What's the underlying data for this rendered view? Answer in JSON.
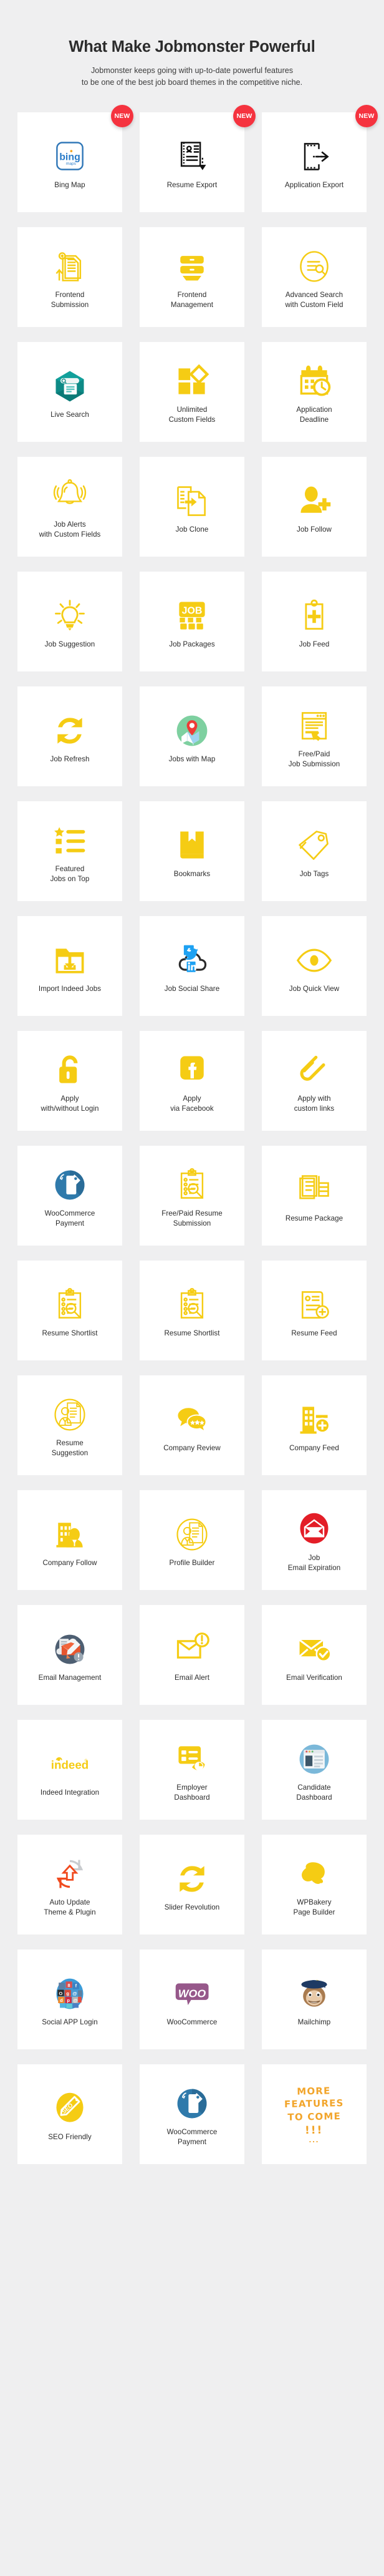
{
  "header": {
    "title": "What Make Jobmonster Powerful",
    "subtitle_line1": "Jobmonster keeps going with up-to-date powerful features",
    "subtitle_line2": "to be one of the best job board themes in the competitive niche."
  },
  "badge": {
    "new_label": "NEW"
  },
  "colors": {
    "background": "#efeff0",
    "card_background": "#ffffff",
    "accent_yellow": "#f5cc14",
    "badge_red": "#f5333f",
    "text": "#2b2b2b",
    "heading": "#2c2c2c",
    "orange_handwriting": "#f2a52b",
    "teal": "#0e8a86",
    "blue": "#3178b8",
    "facebook_blue": "#1da1f2",
    "woo_purple": "#96588a",
    "green": "#7ed0a0"
  },
  "features": [
    {
      "label": "Bing Map",
      "icon": "bing-map-icon",
      "badge": "NEW"
    },
    {
      "label": "Resume Export",
      "icon": "resume-export-icon",
      "badge": "NEW"
    },
    {
      "label": "Application Export",
      "icon": "application-export-icon",
      "badge": "NEW"
    },
    {
      "label": "Frontend\nSubmission",
      "icon": "frontend-submission-icon",
      "badge": ""
    },
    {
      "label": "Frontend\nManagement",
      "icon": "frontend-management-icon",
      "badge": ""
    },
    {
      "label": "Advanced Search\nwith Custom Field",
      "icon": "advanced-search-icon",
      "badge": ""
    },
    {
      "label": "Live Search",
      "icon": "live-search-icon",
      "badge": ""
    },
    {
      "label": "Unlimited\nCustom Fields",
      "icon": "unlimited-custom-fields-icon",
      "badge": ""
    },
    {
      "label": "Application\nDeadline",
      "icon": "application-deadline-icon",
      "badge": ""
    },
    {
      "label": "Job Alerts\nwith Custom Fields",
      "icon": "job-alerts-bell-icon",
      "badge": ""
    },
    {
      "label": "Job Clone",
      "icon": "job-clone-icon",
      "badge": ""
    },
    {
      "label": "Job Follow",
      "icon": "job-follow-user-plus-icon",
      "badge": ""
    },
    {
      "label": "Job Suggestion",
      "icon": "job-suggestion-lightbulb-icon",
      "badge": ""
    },
    {
      "label": "Job Packages",
      "icon": "job-packages-icon",
      "badge": ""
    },
    {
      "label": "Job Feed",
      "icon": "job-feed-icon",
      "badge": ""
    },
    {
      "label": "Job Refresh",
      "icon": "job-refresh-icon",
      "badge": ""
    },
    {
      "label": "Jobs with Map",
      "icon": "jobs-with-map-icon",
      "badge": ""
    },
    {
      "label": "Free/Paid\nJob Submission",
      "icon": "free-paid-job-submission-icon",
      "badge": ""
    },
    {
      "label": "Featured\nJobs on Top",
      "icon": "featured-jobs-list-icon",
      "badge": ""
    },
    {
      "label": "Bookmarks",
      "icon": "bookmarks-book-icon",
      "badge": ""
    },
    {
      "label": "Job Tags",
      "icon": "job-tags-icon",
      "badge": ""
    },
    {
      "label": "Import Indeed Jobs",
      "icon": "import-indeed-jobs-icon",
      "badge": ""
    },
    {
      "label": "Job Social Share",
      "icon": "job-social-share-icon",
      "badge": ""
    },
    {
      "label": "Job Quick View",
      "icon": "job-quick-view-eye-icon",
      "badge": ""
    },
    {
      "label": "Apply\nwith/without Login",
      "icon": "apply-lock-icon",
      "badge": ""
    },
    {
      "label": "Apply\nvia Facebook",
      "icon": "apply-facebook-icon",
      "badge": ""
    },
    {
      "label": "Apply with\ncustom links",
      "icon": "apply-custom-link-icon",
      "badge": ""
    },
    {
      "label": "WooCommerce\nPayment",
      "icon": "woocommerce-payment-icon",
      "badge": ""
    },
    {
      "label": "Free/Paid Resume\nSubmission",
      "icon": "free-paid-resume-icon",
      "badge": ""
    },
    {
      "label": "Resume Package",
      "icon": "resume-package-icon",
      "badge": ""
    },
    {
      "label": "Resume Shortlist",
      "icon": "resume-shortlist-icon",
      "badge": ""
    },
    {
      "label": "Resume Shortlist",
      "icon": "resume-shortlist-icon",
      "badge": ""
    },
    {
      "label": "Resume Feed",
      "icon": "resume-feed-icon",
      "badge": ""
    },
    {
      "label": "Resume\nSuggestion",
      "icon": "resume-suggestion-icon",
      "badge": ""
    },
    {
      "label": "Company Review",
      "icon": "company-review-icon",
      "badge": ""
    },
    {
      "label": "Company Feed",
      "icon": "company-feed-icon",
      "badge": ""
    },
    {
      "label": "Company Follow",
      "icon": "company-follow-icon",
      "badge": ""
    },
    {
      "label": "Profile Builder",
      "icon": "profile-builder-icon",
      "badge": ""
    },
    {
      "label": "Job\nEmail Expiration",
      "icon": "job-email-expiration-icon",
      "badge": ""
    },
    {
      "label": "Email Management",
      "icon": "email-management-icon",
      "badge": ""
    },
    {
      "label": "Email Alert",
      "icon": "email-alert-icon",
      "badge": ""
    },
    {
      "label": "Email Verification",
      "icon": "email-verification-icon",
      "badge": ""
    },
    {
      "label": "Indeed Integration",
      "icon": "indeed-logo-icon",
      "badge": ""
    },
    {
      "label": "Employer\nDashboard",
      "icon": "employer-dashboard-icon",
      "badge": ""
    },
    {
      "label": "Candidate\nDashboard",
      "icon": "candidate-dashboard-icon",
      "badge": ""
    },
    {
      "label": "Auto Update\nTheme & Plugin",
      "icon": "auto-update-icon",
      "badge": ""
    },
    {
      "label": "Slider Revolution",
      "icon": "slider-revolution-icon",
      "badge": ""
    },
    {
      "label": "WPBakery\nPage Builder",
      "icon": "wpbakery-icon",
      "badge": ""
    },
    {
      "label": "Social APP Login",
      "icon": "social-app-login-icon",
      "badge": ""
    },
    {
      "label": "WooCommerce",
      "icon": "woocommerce-logo-icon",
      "badge": ""
    },
    {
      "label": "Mailchimp",
      "icon": "mailchimp-icon",
      "badge": ""
    },
    {
      "label": "SEO Friendly",
      "icon": "seo-friendly-icon",
      "badge": ""
    },
    {
      "label": "WooCommerce\nPayment",
      "icon": "woocommerce-payment-icon",
      "badge": ""
    },
    {
      "label": "",
      "icon": "more-features-handwriting",
      "badge": "",
      "more_text": "MORE\nFEATURES\nTO COME",
      "more_bangs": "!!!",
      "more_dots": "..."
    }
  ]
}
